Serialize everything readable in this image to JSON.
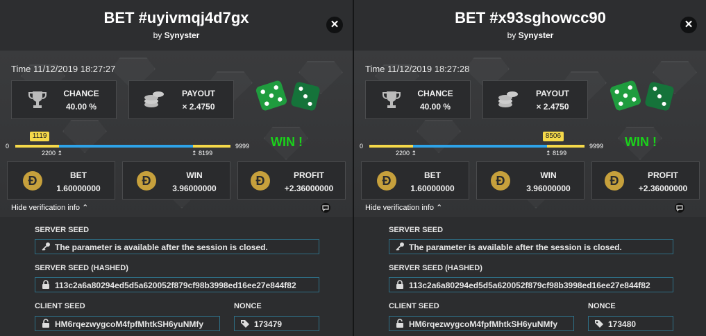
{
  "bets": [
    {
      "title": "BET #uyivmqj4d7gx",
      "by_prefix": "by",
      "author": "Synyster",
      "time": "Time 11/12/2019 18:27:27",
      "chance_label": "CHANCE",
      "chance_value": "40.00 %",
      "payout_label": "PAYOUT",
      "payout_value": "× 2.4750",
      "range_min": "0",
      "range_max": "9999",
      "range_low": "2200",
      "range_high": "8199",
      "roll": "1119",
      "roll_fraction": 0.112,
      "result": "WIN !",
      "bet_label": "BET",
      "bet_value": "1.60000000",
      "win_label": "WIN",
      "win_value": "3.96000000",
      "profit_label": "PROFIT",
      "profit_value": "+2.36000000",
      "verify_toggle": "Hide verification info",
      "server_seed_label": "SERVER SEED",
      "server_seed_value": "The parameter is available after the session is closed.",
      "server_seed_hashed_label": "SERVER SEED (HASHED)",
      "server_seed_hashed_value": "113c2a6a80294ed5d5a620052f879cf98b3998ed16ee27e844f82",
      "client_seed_label": "CLIENT SEED",
      "client_seed_value": "HM6rqezwygcoM4fpfMhtkSH6yuNMfy",
      "nonce_label": "NONCE",
      "nonce_value": "173479"
    },
    {
      "title": "BET #x93sghowcc90",
      "by_prefix": "by",
      "author": "Synyster",
      "time": "Time 11/12/2019 18:27:28",
      "chance_label": "CHANCE",
      "chance_value": "40.00 %",
      "payout_label": "PAYOUT",
      "payout_value": "× 2.4750",
      "range_min": "0",
      "range_max": "9999",
      "range_low": "2200",
      "range_high": "8199",
      "roll": "8506",
      "roll_fraction": 0.851,
      "result": "WIN !",
      "bet_label": "BET",
      "bet_value": "1.60000000",
      "win_label": "WIN",
      "win_value": "3.96000000",
      "profit_label": "PROFIT",
      "profit_value": "+2.36000000",
      "verify_toggle": "Hide verification info",
      "server_seed_label": "SERVER SEED",
      "server_seed_value": "The parameter is available after the session is closed.",
      "server_seed_hashed_label": "SERVER SEED (HASHED)",
      "server_seed_hashed_value": "113c2a6a80294ed5d5a620052f879cf98b3998ed16ee27e844f82",
      "client_seed_label": "CLIENT SEED",
      "client_seed_value": "HM6rqezwygcoM4fpfMhtkSH6yuNMfy",
      "nonce_label": "NONCE",
      "nonce_value": "173480"
    }
  ],
  "icons": {
    "close": "close-icon",
    "trophy": "trophy-icon",
    "coins": "coins-stack-icon",
    "dice": "dice-icon",
    "currency": "dogecoin-icon",
    "key": "key-icon",
    "lock": "lock-icon",
    "unlock": "unlock-icon",
    "tag": "tag-icon",
    "chat": "chat-icon",
    "chevron": "chevron-up-icon"
  },
  "colors": {
    "win": "#1ad31a",
    "range_yellow": "#f5d94a",
    "range_blue": "#2ea3e8",
    "coin_gold": "#c6a03c",
    "dice_green": "#1f9c3e",
    "field_border": "#2e6f86"
  }
}
